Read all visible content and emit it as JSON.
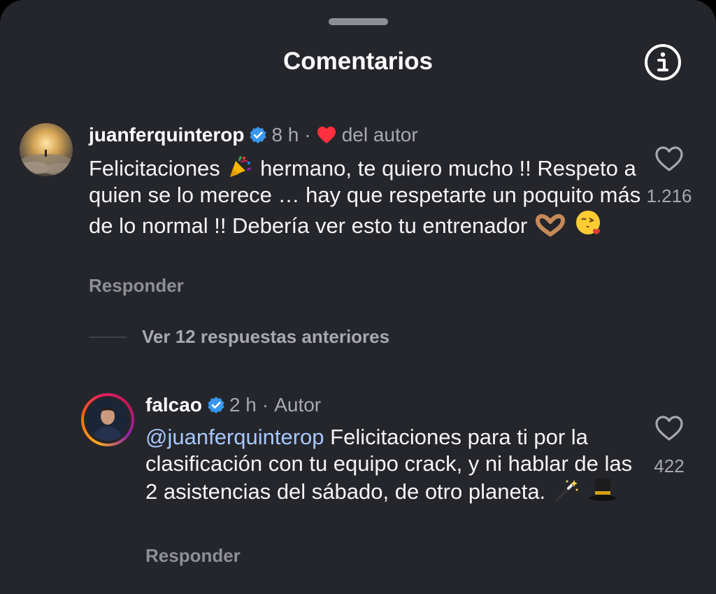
{
  "header": {
    "title": "Comentarios",
    "info_icon": "info-icon"
  },
  "comments": [
    {
      "username": "juanferquinterop",
      "verified": true,
      "time": "8 h",
      "author_like_label": "del autor",
      "text_parts": [
        "Felicitaciones",
        "hermano, te quiero mucho !! Respeto a quien se lo merece … hay que respetarte un poquito más de lo normal !! Debería ver esto tu entrenador"
      ],
      "emojis": [
        "party-popper",
        "heart-hands",
        "face-blowing-kiss"
      ],
      "reply_label": "Responder",
      "like_count": "1.216"
    },
    {
      "username": "falcao",
      "verified": true,
      "time": "2 h",
      "author_label": "Autor",
      "mention": "@juanferquinterop",
      "text": "Felicitaciones para ti por la clasificación con tu equipo crack, y ni hablar de las 2 asistencias del sábado, de otro planeta.",
      "emojis": [
        "magic-wand",
        "top-hat"
      ],
      "reply_label": "Responder",
      "like_count": "422"
    }
  ],
  "view_replies_label": "Ver 12 respuestas anteriores",
  "colors": {
    "background": "#25262b",
    "verified": "#3897f0",
    "author_heart": "#ff3040",
    "mention": "#a5c8ff"
  }
}
